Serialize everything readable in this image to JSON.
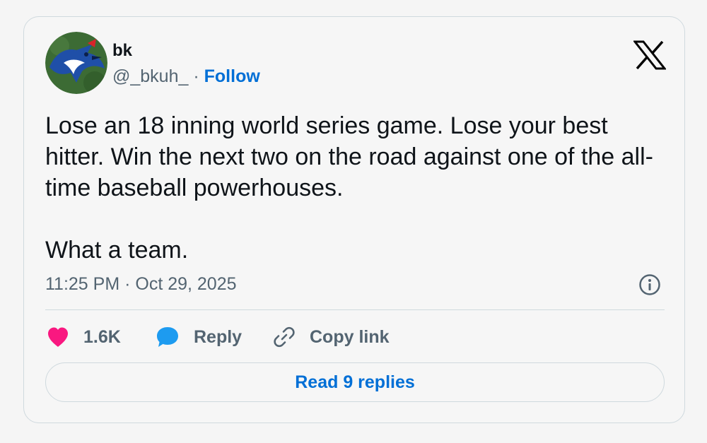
{
  "author": {
    "name": "bk",
    "handle": "@_bkuh_",
    "separator": "·",
    "follow_label": "Follow"
  },
  "tweet": {
    "paragraphs": [
      "Lose an 18 inning world series game. Lose your best hitter. Win the next two on the road against one of the all-time baseball powerhouses.",
      "What a team."
    ],
    "timestamp": "11:25 PM · Oct 29, 2025"
  },
  "actions": {
    "likes": "1.6K",
    "reply_label": "Reply",
    "copy_link_label": "Copy link"
  },
  "read_replies_label": "Read 9 replies",
  "icons": {
    "logo": "x-logo-icon",
    "info": "info-icon",
    "like": "heart-icon",
    "reply": "chat-bubble-icon",
    "copy": "link-icon"
  },
  "colors": {
    "accent": "#006fd6",
    "like": "#f91880",
    "reply": "#1d9bf0",
    "muted": "#536471",
    "text": "#0f1419",
    "border": "#cfd9de"
  }
}
